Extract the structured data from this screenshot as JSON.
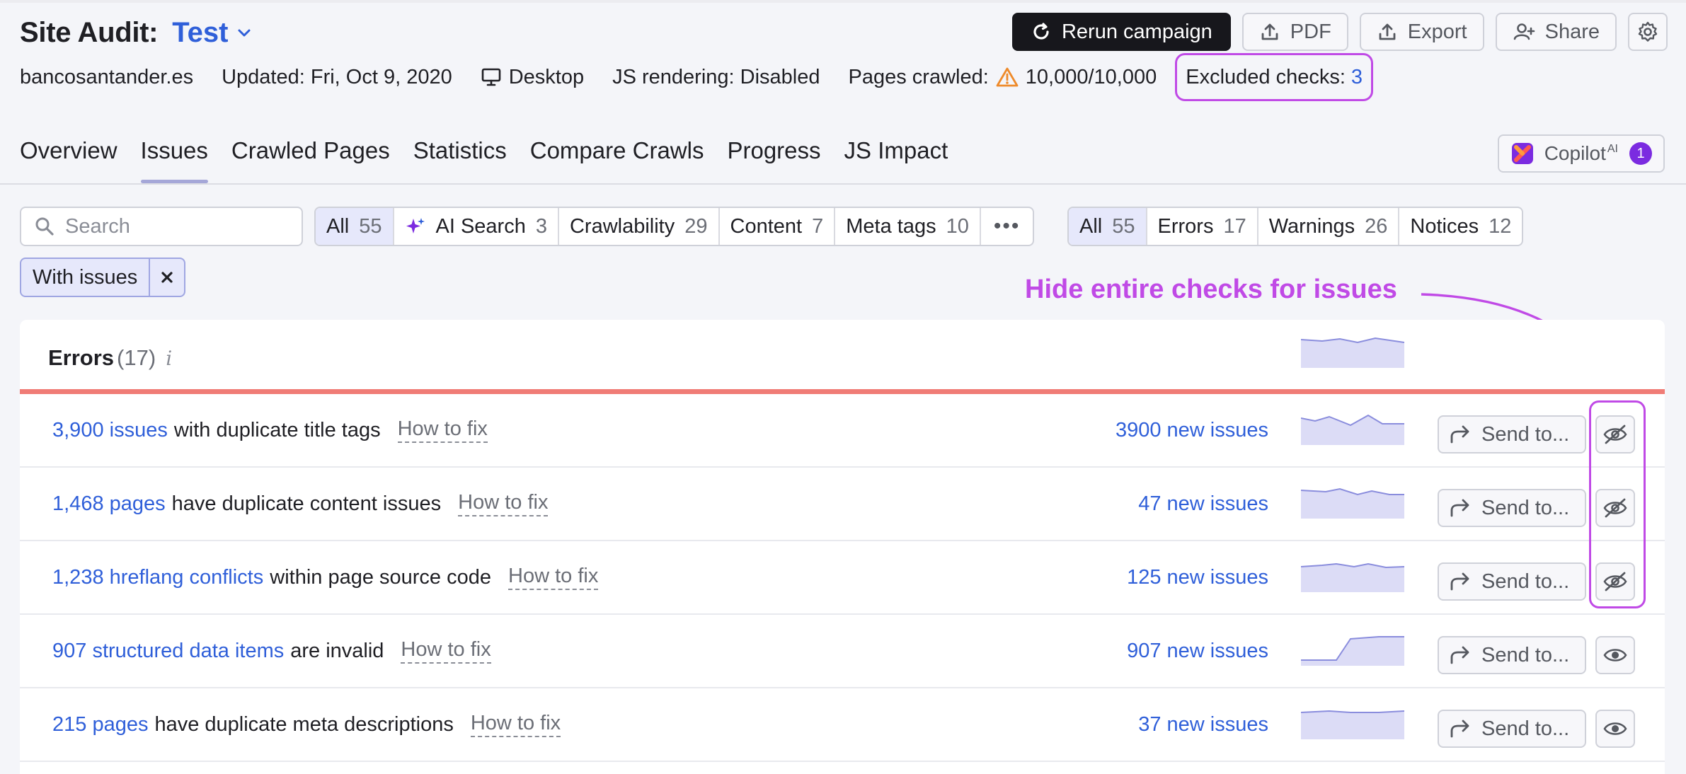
{
  "header": {
    "title": "Site Audit:",
    "project": "Test",
    "buttons": {
      "rerun": "Rerun campaign",
      "pdf": "PDF",
      "export": "Export",
      "share": "Share"
    }
  },
  "meta": {
    "domain": "bancosantander.es",
    "updated": "Updated: Fri, Oct 9, 2020",
    "device": "Desktop",
    "js_rendering": "JS rendering: Disabled",
    "pages_crawled_label": "Pages crawled:",
    "pages_crawled_value": "10,000/10,000",
    "excluded_label": "Excluded checks:",
    "excluded_value": "3"
  },
  "tabs": [
    "Overview",
    "Issues",
    "Crawled Pages",
    "Statistics",
    "Compare Crawls",
    "Progress",
    "JS Impact"
  ],
  "active_tab": "Issues",
  "copilot": {
    "label": "Copilot",
    "sup": "AI",
    "badge": "1"
  },
  "search": {
    "placeholder": "Search"
  },
  "category_filters": [
    {
      "label": "All",
      "count": "55"
    },
    {
      "label": "AI Search",
      "count": "3"
    },
    {
      "label": "Crawlability",
      "count": "29"
    },
    {
      "label": "Content",
      "count": "7"
    },
    {
      "label": "Meta tags",
      "count": "10"
    }
  ],
  "more_label": "•••",
  "severity_filters": [
    {
      "label": "All",
      "count": "55"
    },
    {
      "label": "Errors",
      "count": "17"
    },
    {
      "label": "Warnings",
      "count": "26"
    },
    {
      "label": "Notices",
      "count": "12"
    }
  ],
  "active_chip": "With issues",
  "annotation": "Hide entire checks for issues",
  "section": {
    "title": "Errors",
    "count": "(17)",
    "info": "i"
  },
  "send_label": "Send to...",
  "fix_label": "How to fix",
  "rows": [
    {
      "link": "3,900 issues",
      "text": "with duplicate title tags",
      "new_issues": "3900 new issues",
      "hidden": true
    },
    {
      "link": "1,468 pages",
      "text": "have duplicate content issues",
      "new_issues": "47 new issues",
      "hidden": true
    },
    {
      "link": "1,238 hreflang conflicts",
      "text": "within page source code",
      "new_issues": "125 new issues",
      "hidden": true
    },
    {
      "link": "907 structured data items",
      "text": "are invalid",
      "new_issues": "907 new issues",
      "hidden": false
    },
    {
      "link": "215 pages",
      "text": "have duplicate meta descriptions",
      "new_issues": "37 new issues",
      "hidden": false
    }
  ],
  "colors": {
    "accent_link": "#2f5fd9",
    "annotation": "#c04ae6",
    "error_bar": "#f07c76",
    "spark_fill": "#dcdcf6",
    "spark_line": "#8a8ddd"
  }
}
